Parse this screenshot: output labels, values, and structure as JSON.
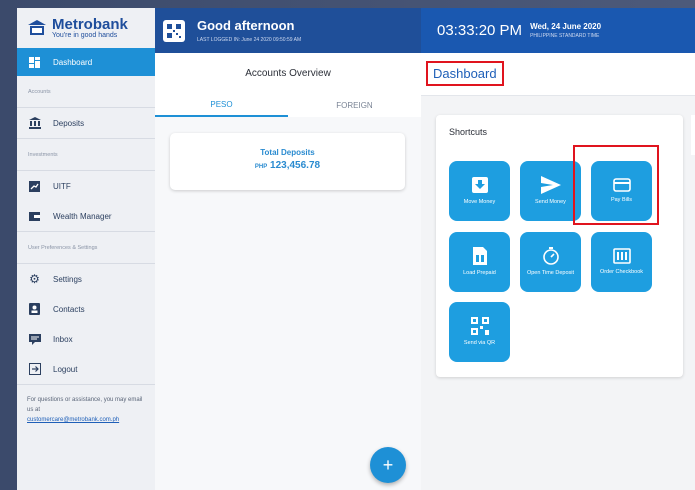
{
  "brand": {
    "name": "Metrobank",
    "tagline": "You're in good hands"
  },
  "sidebar": {
    "dashboard": "Dashboard",
    "section_accounts": "Accounts",
    "deposits": "Deposits",
    "section_investments": "Investments",
    "uitf": "UITF",
    "wealth_manager": "Wealth Manager",
    "section_prefs": "User Preferences & Settings",
    "settings": "Settings",
    "contacts": "Contacts",
    "inbox": "Inbox",
    "logout": "Logout",
    "help_text": "For questions or assistance, you may email us at",
    "help_email": "customercare@metrobank.com.ph"
  },
  "header": {
    "greeting": "Good afternoon",
    "last_logged": "LAST LOGGED IN: June 24 2020 09:50:59 AM",
    "time": "03:33:20 PM",
    "date": "Wed, 24 June 2020",
    "timezone": "PHILIPPINE STANDARD TIME"
  },
  "accounts": {
    "title": "Accounts Overview",
    "tabs": [
      "PESO",
      "FOREIGN"
    ],
    "total_label": "Total Deposits",
    "currency": "PHP",
    "total_amount": "123,456.78",
    "fab": "+"
  },
  "dashboard": {
    "title": "Dashboard",
    "shortcuts_title": "Shortcuts",
    "tiles": [
      {
        "label": "Move Money",
        "icon": "move-money-icon"
      },
      {
        "label": "Send Money",
        "icon": "send-icon"
      },
      {
        "label": "Pay Bills",
        "icon": "card-icon"
      },
      {
        "label": "Load Prepaid",
        "icon": "sim-card-icon"
      },
      {
        "label": "Open Time Deposit",
        "icon": "timer-icon"
      },
      {
        "label": "Order Checkbook",
        "icon": "checkbook-icon"
      },
      {
        "label": "Send via QR",
        "icon": "qr-code-icon"
      }
    ]
  },
  "colors": {
    "primary": "#1e90d6",
    "header_dark": "#1f4f99",
    "highlight": "#e0141e"
  }
}
